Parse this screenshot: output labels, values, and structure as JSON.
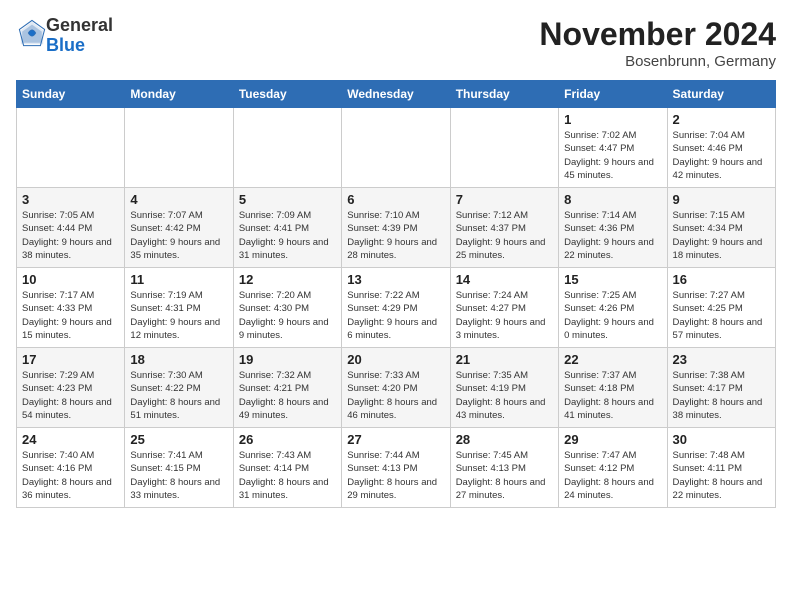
{
  "header": {
    "logo_line1": "General",
    "logo_line2": "Blue",
    "month": "November 2024",
    "location": "Bosenbrunn, Germany"
  },
  "weekdays": [
    "Sunday",
    "Monday",
    "Tuesday",
    "Wednesday",
    "Thursday",
    "Friday",
    "Saturday"
  ],
  "weeks": [
    [
      {
        "day": "",
        "info": ""
      },
      {
        "day": "",
        "info": ""
      },
      {
        "day": "",
        "info": ""
      },
      {
        "day": "",
        "info": ""
      },
      {
        "day": "",
        "info": ""
      },
      {
        "day": "1",
        "info": "Sunrise: 7:02 AM\nSunset: 4:47 PM\nDaylight: 9 hours and 45 minutes."
      },
      {
        "day": "2",
        "info": "Sunrise: 7:04 AM\nSunset: 4:46 PM\nDaylight: 9 hours and 42 minutes."
      }
    ],
    [
      {
        "day": "3",
        "info": "Sunrise: 7:05 AM\nSunset: 4:44 PM\nDaylight: 9 hours and 38 minutes."
      },
      {
        "day": "4",
        "info": "Sunrise: 7:07 AM\nSunset: 4:42 PM\nDaylight: 9 hours and 35 minutes."
      },
      {
        "day": "5",
        "info": "Sunrise: 7:09 AM\nSunset: 4:41 PM\nDaylight: 9 hours and 31 minutes."
      },
      {
        "day": "6",
        "info": "Sunrise: 7:10 AM\nSunset: 4:39 PM\nDaylight: 9 hours and 28 minutes."
      },
      {
        "day": "7",
        "info": "Sunrise: 7:12 AM\nSunset: 4:37 PM\nDaylight: 9 hours and 25 minutes."
      },
      {
        "day": "8",
        "info": "Sunrise: 7:14 AM\nSunset: 4:36 PM\nDaylight: 9 hours and 22 minutes."
      },
      {
        "day": "9",
        "info": "Sunrise: 7:15 AM\nSunset: 4:34 PM\nDaylight: 9 hours and 18 minutes."
      }
    ],
    [
      {
        "day": "10",
        "info": "Sunrise: 7:17 AM\nSunset: 4:33 PM\nDaylight: 9 hours and 15 minutes."
      },
      {
        "day": "11",
        "info": "Sunrise: 7:19 AM\nSunset: 4:31 PM\nDaylight: 9 hours and 12 minutes."
      },
      {
        "day": "12",
        "info": "Sunrise: 7:20 AM\nSunset: 4:30 PM\nDaylight: 9 hours and 9 minutes."
      },
      {
        "day": "13",
        "info": "Sunrise: 7:22 AM\nSunset: 4:29 PM\nDaylight: 9 hours and 6 minutes."
      },
      {
        "day": "14",
        "info": "Sunrise: 7:24 AM\nSunset: 4:27 PM\nDaylight: 9 hours and 3 minutes."
      },
      {
        "day": "15",
        "info": "Sunrise: 7:25 AM\nSunset: 4:26 PM\nDaylight: 9 hours and 0 minutes."
      },
      {
        "day": "16",
        "info": "Sunrise: 7:27 AM\nSunset: 4:25 PM\nDaylight: 8 hours and 57 minutes."
      }
    ],
    [
      {
        "day": "17",
        "info": "Sunrise: 7:29 AM\nSunset: 4:23 PM\nDaylight: 8 hours and 54 minutes."
      },
      {
        "day": "18",
        "info": "Sunrise: 7:30 AM\nSunset: 4:22 PM\nDaylight: 8 hours and 51 minutes."
      },
      {
        "day": "19",
        "info": "Sunrise: 7:32 AM\nSunset: 4:21 PM\nDaylight: 8 hours and 49 minutes."
      },
      {
        "day": "20",
        "info": "Sunrise: 7:33 AM\nSunset: 4:20 PM\nDaylight: 8 hours and 46 minutes."
      },
      {
        "day": "21",
        "info": "Sunrise: 7:35 AM\nSunset: 4:19 PM\nDaylight: 8 hours and 43 minutes."
      },
      {
        "day": "22",
        "info": "Sunrise: 7:37 AM\nSunset: 4:18 PM\nDaylight: 8 hours and 41 minutes."
      },
      {
        "day": "23",
        "info": "Sunrise: 7:38 AM\nSunset: 4:17 PM\nDaylight: 8 hours and 38 minutes."
      }
    ],
    [
      {
        "day": "24",
        "info": "Sunrise: 7:40 AM\nSunset: 4:16 PM\nDaylight: 8 hours and 36 minutes."
      },
      {
        "day": "25",
        "info": "Sunrise: 7:41 AM\nSunset: 4:15 PM\nDaylight: 8 hours and 33 minutes."
      },
      {
        "day": "26",
        "info": "Sunrise: 7:43 AM\nSunset: 4:14 PM\nDaylight: 8 hours and 31 minutes."
      },
      {
        "day": "27",
        "info": "Sunrise: 7:44 AM\nSunset: 4:13 PM\nDaylight: 8 hours and 29 minutes."
      },
      {
        "day": "28",
        "info": "Sunrise: 7:45 AM\nSunset: 4:13 PM\nDaylight: 8 hours and 27 minutes."
      },
      {
        "day": "29",
        "info": "Sunrise: 7:47 AM\nSunset: 4:12 PM\nDaylight: 8 hours and 24 minutes."
      },
      {
        "day": "30",
        "info": "Sunrise: 7:48 AM\nSunset: 4:11 PM\nDaylight: 8 hours and 22 minutes."
      }
    ]
  ]
}
